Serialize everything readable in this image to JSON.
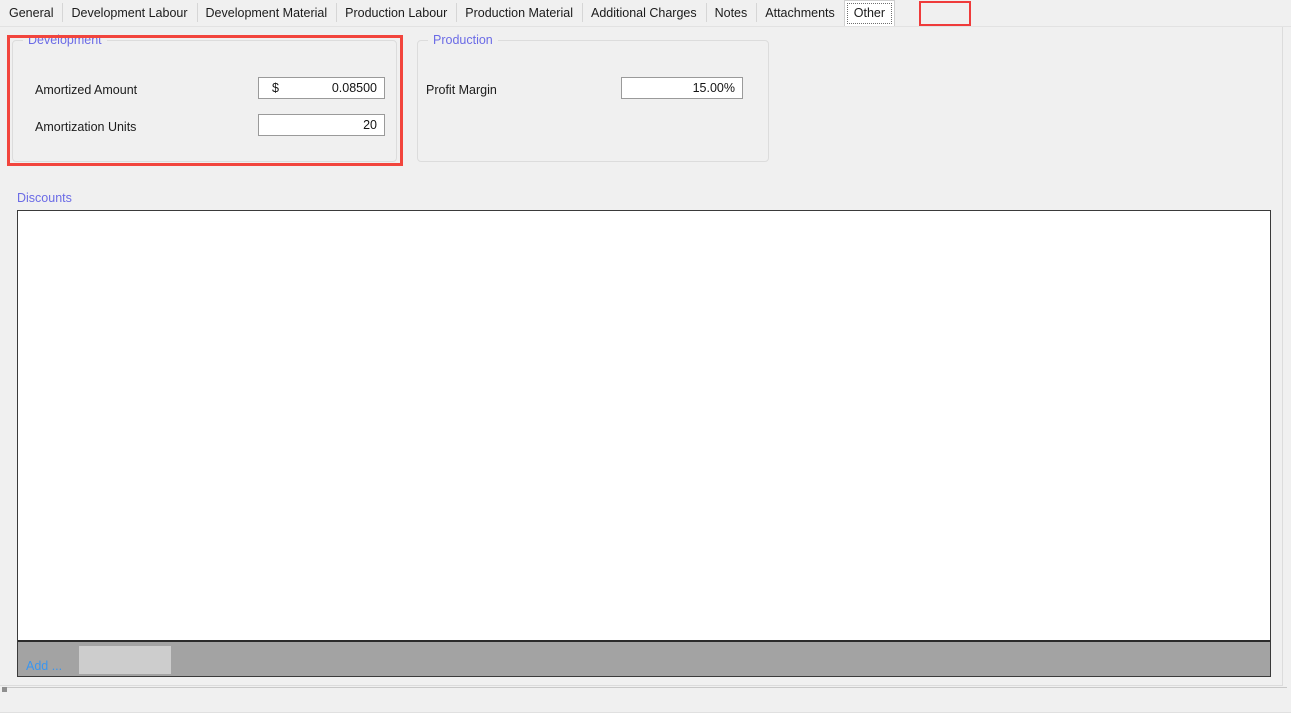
{
  "tabs": [
    {
      "label": "General",
      "selected": false
    },
    {
      "label": "Development Labour",
      "selected": false
    },
    {
      "label": "Development Material",
      "selected": false
    },
    {
      "label": "Production Labour",
      "selected": false
    },
    {
      "label": "Production Material",
      "selected": false
    },
    {
      "label": "Additional Charges",
      "selected": false
    },
    {
      "label": "Notes",
      "selected": false
    },
    {
      "label": "Attachments",
      "selected": false
    },
    {
      "label": "Other",
      "selected": true
    }
  ],
  "groups": {
    "development": {
      "title": "Development",
      "fields": [
        {
          "label": "Amortized Amount",
          "prefix": "$",
          "value": "0.08500"
        },
        {
          "label": "Amortization Units",
          "prefix": "",
          "value": "20"
        }
      ]
    },
    "production": {
      "title": "Production",
      "fields": [
        {
          "label": "Profit Margin",
          "prefix": "",
          "value": "15.00%"
        }
      ]
    }
  },
  "discounts": {
    "title": "Discounts",
    "add_label": "Add ...",
    "rows": []
  },
  "colors": {
    "group_label": "#6b6be6",
    "highlight_red": "#f2453d",
    "add_link_blue": "#3a96f0",
    "addbar_gray": "#a3a3a3",
    "panel_background": "#f0f0f0"
  }
}
